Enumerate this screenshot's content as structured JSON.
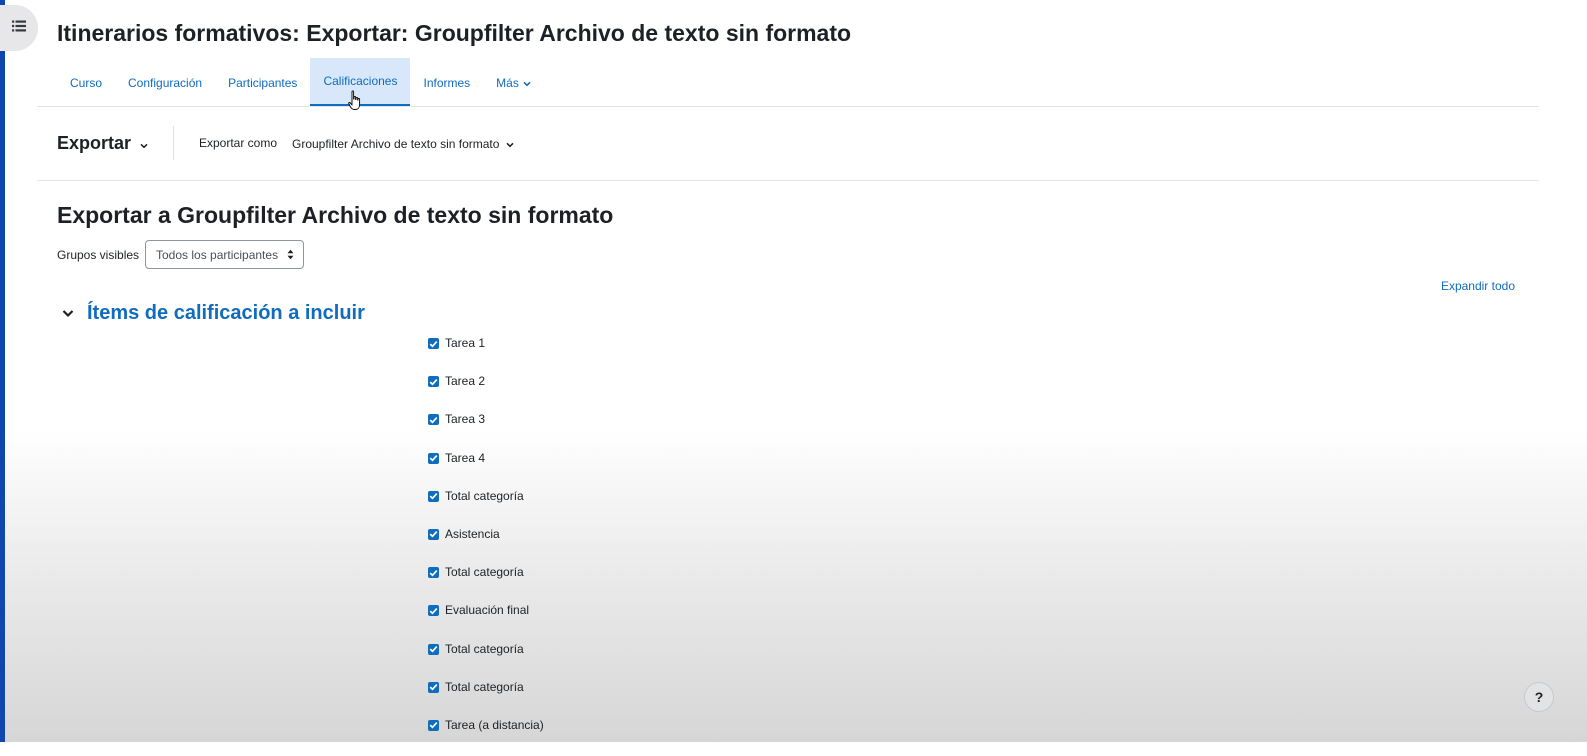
{
  "page": {
    "title": "Itinerarios formativos: Exportar: Groupfilter Archivo de texto sin formato"
  },
  "sidebar": {
    "toggle_icon": "list-icon"
  },
  "nav": {
    "tabs": [
      {
        "label": "Curso",
        "active": false
      },
      {
        "label": "Configuración",
        "active": false
      },
      {
        "label": "Participantes",
        "active": false
      },
      {
        "label": "Calificaciones",
        "active": true
      },
      {
        "label": "Informes",
        "active": false
      },
      {
        "label": "Más",
        "active": false,
        "has_dropdown": true
      }
    ]
  },
  "tertiary": {
    "menu_label": "Exportar",
    "export_as_label": "Exportar como",
    "export_as_value": "Groupfilter Archivo de texto sin formato"
  },
  "main": {
    "heading": "Exportar a Groupfilter Archivo de texto sin formato",
    "groups": {
      "label": "Grupos visibles",
      "selected": "Todos los participantes"
    },
    "expand_all": "Expandir todo",
    "fieldset": {
      "legend": "Ítems de calificación a incluir",
      "expanded": true,
      "items": [
        {
          "label": "Tarea 1",
          "checked": true
        },
        {
          "label": "Tarea 2",
          "checked": true
        },
        {
          "label": "Tarea 3",
          "checked": true
        },
        {
          "label": "Tarea 4",
          "checked": true
        },
        {
          "label": "Total categoría",
          "checked": true
        },
        {
          "label": "Asistencia",
          "checked": true
        },
        {
          "label": "Total categoría",
          "checked": true
        },
        {
          "label": "Evaluación final",
          "checked": true
        },
        {
          "label": "Total categoría",
          "checked": true
        },
        {
          "label": "Total categoría",
          "checked": true
        },
        {
          "label": "Tarea (a distancia)",
          "checked": true
        }
      ]
    }
  },
  "footer": {
    "help_label": "?"
  },
  "colors": {
    "accent": "#0f6cbf",
    "active_tab_bg": "#d8e7f9",
    "left_bar": "#0f47ad",
    "text": "#1d2125"
  }
}
